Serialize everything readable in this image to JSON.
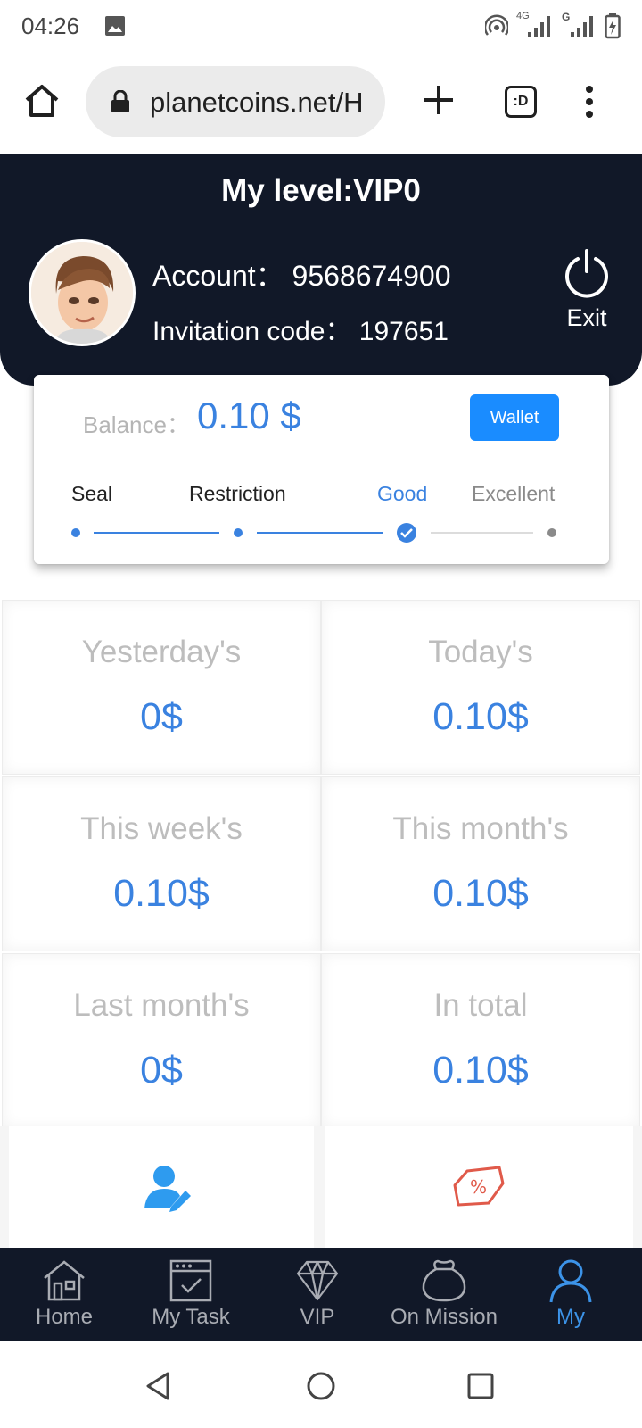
{
  "status_bar": {
    "time": "04:26",
    "icons": [
      "gallery-icon",
      "hotspot-icon",
      "signal-4g-icon",
      "signal-g-icon",
      "battery-charging-icon"
    ],
    "network_labels": [
      "4G",
      "G"
    ]
  },
  "browser": {
    "url": "planetcoins.net/H",
    "tabs_label": ":D",
    "icons": [
      "home-icon",
      "lock-icon",
      "plus-icon",
      "tabs-icon",
      "more-vert-icon"
    ]
  },
  "profile": {
    "level_title": "My level:VIP0",
    "account_text": "Account： 9568674900",
    "invitation_text": "Invitation code： 197651",
    "exit_label": "Exit",
    "colors": {
      "header_bg": "#111828"
    }
  },
  "balance": {
    "label": "Balance：",
    "value": "0.10 $",
    "wallet_label": "Wallet",
    "steps": [
      {
        "label": "Seal",
        "state": "done"
      },
      {
        "label": "Restriction",
        "state": "done"
      },
      {
        "label": "Good",
        "state": "current"
      },
      {
        "label": "Excellent",
        "state": "pending"
      }
    ],
    "colors": {
      "accent": "#3a82e0",
      "wallet_bg": "#1a8cff"
    }
  },
  "stats": [
    {
      "title": "Yesterday's",
      "value": "0$"
    },
    {
      "title": "Today's",
      "value": "0.10$"
    },
    {
      "title": "This week's",
      "value": "0.10$"
    },
    {
      "title": "This month's",
      "value": "0.10$"
    },
    {
      "title": "Last month's",
      "value": "0$"
    },
    {
      "title": "In total",
      "value": "0.10$"
    }
  ],
  "shortcuts": [
    {
      "icon": "user-edit-icon"
    },
    {
      "icon": "discount-tag-icon"
    }
  ],
  "tabbar": {
    "items": [
      {
        "label": "Home",
        "icon": "home-building-icon"
      },
      {
        "label": "My Task",
        "icon": "task-calendar-icon"
      },
      {
        "label": "VIP",
        "icon": "diamond-icon"
      },
      {
        "label": "On Mission",
        "icon": "money-bag-icon"
      },
      {
        "label": "My",
        "icon": "user-icon",
        "active": true
      }
    ],
    "active_color": "#3c93e8"
  },
  "system_nav": {
    "icons": [
      "back-icon",
      "home-circle-icon",
      "recents-icon"
    ]
  }
}
